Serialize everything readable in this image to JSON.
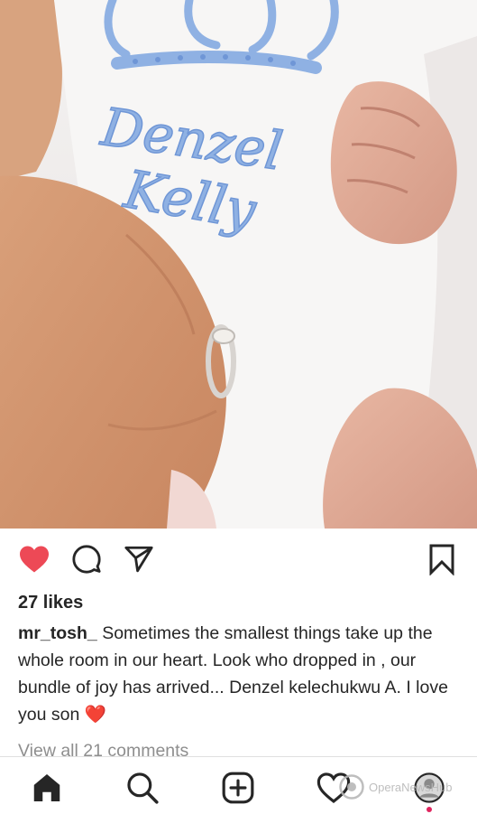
{
  "post": {
    "embroidery_line1": "Denzel",
    "embroidery_line2": "Kelly",
    "likes": "27 likes",
    "username": "mr_tosh_",
    "caption": " Sometimes the smallest things take up the whole room in our heart. Look who dropped in , our bundle of joy has arrived... Denzel kelechukwu A. I love you son ",
    "caption_emoji": "❤️",
    "view_comments": "View all 21 comments",
    "liked": true
  },
  "icons": {
    "like": "heart-filled-icon",
    "comment": "comment-bubble-icon",
    "share": "paper-plane-icon",
    "save": "bookmark-icon",
    "nav": [
      "home-icon",
      "search-icon",
      "add-post-icon",
      "activity-heart-icon",
      "profile-avatar-icon"
    ]
  },
  "watermark": {
    "text": "OperaNewsHub"
  },
  "colors": {
    "heart": "#ed4956",
    "text": "#262626",
    "muted": "#8e8e8e",
    "embroidery": "#8fb1e3",
    "notification_dot": "#e0245e"
  }
}
